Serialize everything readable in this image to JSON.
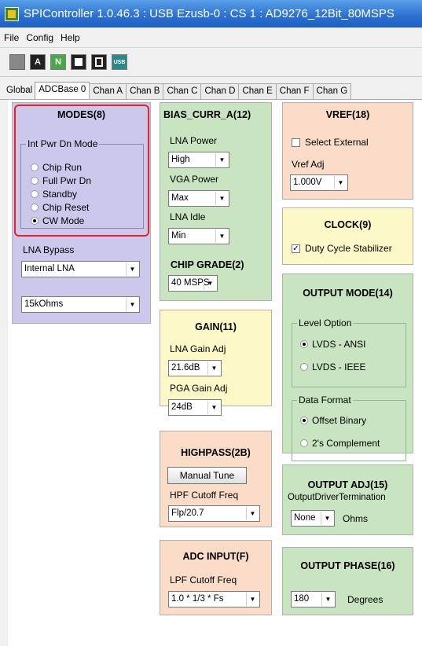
{
  "window": {
    "title": "SPIController 1.0.46.3 : USB Ezusb-0 : CS 1 : AD9276_12Bit_80MSPS"
  },
  "menu": [
    "File",
    "Config",
    "Help"
  ],
  "toolbar": {
    "btn1": "",
    "btn2": "A",
    "btn3": "N",
    "btn4": "",
    "btn5": "",
    "btn6": "USB"
  },
  "tabs": [
    "Global",
    "ADCBase 0",
    "Chan A",
    "Chan B",
    "Chan C",
    "Chan D",
    "Chan E",
    "Chan F",
    "Chan G"
  ],
  "modes": {
    "title": "MODES(8)",
    "group": "Int Pwr Dn Mode",
    "options": [
      "Chip Run",
      "Full Pwr Dn",
      "Standby",
      "Chip Reset",
      "CW Mode"
    ],
    "lna_bypass_label": "LNA Bypass",
    "lna_bypass": "Internal LNA",
    "resistance": "15kOhms"
  },
  "bias": {
    "title": "BIAS_CURR_A(12)",
    "lna_power_label": "LNA Power",
    "lna_power": "High",
    "vga_power_label": "VGA Power",
    "vga_power": "Max",
    "lna_idle_label": "LNA Idle",
    "lna_idle": "Min"
  },
  "chip_grade": {
    "title": "CHIP GRADE(2)",
    "value": "40 MSPS"
  },
  "vref": {
    "title": "VREF(18)",
    "select_external": "Select External",
    "vref_adj_label": "Vref Adj",
    "vref_adj": "1.000V"
  },
  "clock": {
    "title": "CLOCK(9)",
    "dcs": "Duty Cycle Stabilizer"
  },
  "gain": {
    "title": "GAIN(11)",
    "lna_gain_label": "LNA Gain Adj",
    "lna_gain": "21.6dB",
    "pga_gain_label": "PGA Gain Adj",
    "pga_gain": "24dB"
  },
  "output_mode": {
    "title": "OUTPUT MODE(14)",
    "level_group": "Level Option",
    "levels": [
      "LVDS - ANSI",
      "LVDS - IEEE"
    ],
    "format_group": "Data Format",
    "formats": [
      "Offset Binary",
      "2's Complement"
    ]
  },
  "highpass": {
    "title": "HIGHPASS(2B)",
    "manual_tune": "Manual Tune",
    "hpf_label": "HPF Cutoff Freq",
    "hpf": "Flp/20.7"
  },
  "output_adj": {
    "title": "OUTPUT ADJ(15)",
    "termination_label": "OutputDriverTermination",
    "termination": "None",
    "unit": "Ohms"
  },
  "adc_input": {
    "title": "ADC INPUT(F)",
    "lpf_label": "LPF Cutoff Freq",
    "lpf": "1.0 * 1/3 * Fs"
  },
  "output_phase": {
    "title": "OUTPUT PHASE(16)",
    "value": "180",
    "unit": "Degrees"
  },
  "colors": {
    "modes": "#ccc8ec",
    "bias": "#c8e4c0",
    "vref": "#fadcc8",
    "clock": "#fcf8c8",
    "gain": "#fcf8c8",
    "output": "#c8e4c0",
    "highpass": "#fadcc8",
    "adc": "#fadcc8",
    "highlight": "#e8202a"
  }
}
